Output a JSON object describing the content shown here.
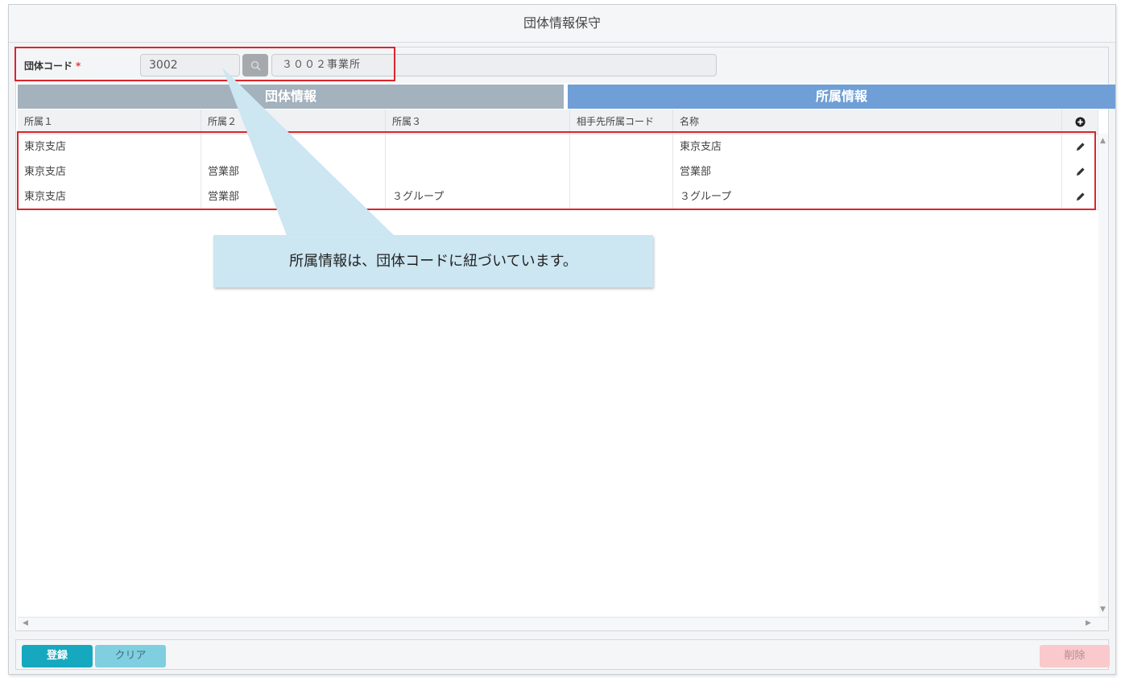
{
  "window": {
    "title": "団体情報保守"
  },
  "form": {
    "code_label": "団体コード",
    "required_mark": "*",
    "code_value": "3002",
    "name_value": "３００２事業所"
  },
  "sections": {
    "left": "団体情報",
    "right": "所属情報"
  },
  "grid": {
    "columns": [
      "所属１",
      "所属２",
      "所属３",
      "相手先所属コード",
      "名称"
    ],
    "rows": [
      [
        "東京支店",
        "",
        "",
        "",
        "東京支店"
      ],
      [
        "東京支店",
        "営業部",
        "",
        "",
        "営業部"
      ],
      [
        "東京支店",
        "営業部",
        "３グループ",
        "",
        "３グループ"
      ]
    ]
  },
  "footer": {
    "register": "登録",
    "clear": "クリア",
    "delete": "削除"
  },
  "callout": {
    "text": "所属情報は、団体コードに紐づいています。"
  },
  "icons": [
    "search-icon",
    "add-circle-icon",
    "edit-pencil-icon",
    "scroll-up-icon",
    "scroll-left-icon",
    "scroll-right-icon",
    "scroll-down-icon"
  ],
  "colors": {
    "section_left": "#a3b2bd",
    "section_right": "#6f9fd6",
    "register": "#16a8be",
    "clear": "#7fcfe0",
    "delete": "#f9c9cc",
    "highlight": "#d9262c",
    "callout": "#cce6f2"
  }
}
